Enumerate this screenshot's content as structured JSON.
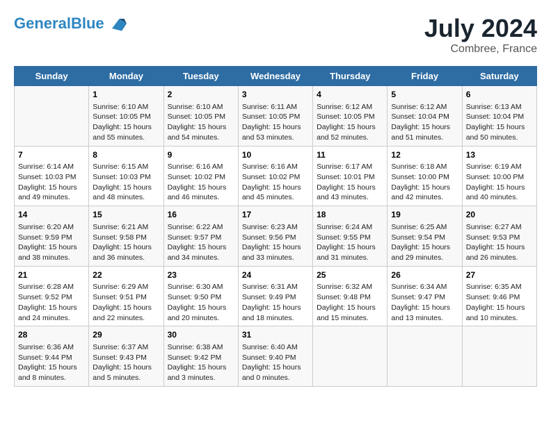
{
  "header": {
    "logo_line1": "General",
    "logo_line2": "Blue",
    "month": "July 2024",
    "location": "Combree, France"
  },
  "columns": [
    "Sunday",
    "Monday",
    "Tuesday",
    "Wednesday",
    "Thursday",
    "Friday",
    "Saturday"
  ],
  "weeks": [
    [
      {
        "day": "",
        "info": ""
      },
      {
        "day": "1",
        "info": "Sunrise: 6:10 AM\nSunset: 10:05 PM\nDaylight: 15 hours\nand 55 minutes."
      },
      {
        "day": "2",
        "info": "Sunrise: 6:10 AM\nSunset: 10:05 PM\nDaylight: 15 hours\nand 54 minutes."
      },
      {
        "day": "3",
        "info": "Sunrise: 6:11 AM\nSunset: 10:05 PM\nDaylight: 15 hours\nand 53 minutes."
      },
      {
        "day": "4",
        "info": "Sunrise: 6:12 AM\nSunset: 10:05 PM\nDaylight: 15 hours\nand 52 minutes."
      },
      {
        "day": "5",
        "info": "Sunrise: 6:12 AM\nSunset: 10:04 PM\nDaylight: 15 hours\nand 51 minutes."
      },
      {
        "day": "6",
        "info": "Sunrise: 6:13 AM\nSunset: 10:04 PM\nDaylight: 15 hours\nand 50 minutes."
      }
    ],
    [
      {
        "day": "7",
        "info": "Sunrise: 6:14 AM\nSunset: 10:03 PM\nDaylight: 15 hours\nand 49 minutes."
      },
      {
        "day": "8",
        "info": "Sunrise: 6:15 AM\nSunset: 10:03 PM\nDaylight: 15 hours\nand 48 minutes."
      },
      {
        "day": "9",
        "info": "Sunrise: 6:16 AM\nSunset: 10:02 PM\nDaylight: 15 hours\nand 46 minutes."
      },
      {
        "day": "10",
        "info": "Sunrise: 6:16 AM\nSunset: 10:02 PM\nDaylight: 15 hours\nand 45 minutes."
      },
      {
        "day": "11",
        "info": "Sunrise: 6:17 AM\nSunset: 10:01 PM\nDaylight: 15 hours\nand 43 minutes."
      },
      {
        "day": "12",
        "info": "Sunrise: 6:18 AM\nSunset: 10:00 PM\nDaylight: 15 hours\nand 42 minutes."
      },
      {
        "day": "13",
        "info": "Sunrise: 6:19 AM\nSunset: 10:00 PM\nDaylight: 15 hours\nand 40 minutes."
      }
    ],
    [
      {
        "day": "14",
        "info": "Sunrise: 6:20 AM\nSunset: 9:59 PM\nDaylight: 15 hours\nand 38 minutes."
      },
      {
        "day": "15",
        "info": "Sunrise: 6:21 AM\nSunset: 9:58 PM\nDaylight: 15 hours\nand 36 minutes."
      },
      {
        "day": "16",
        "info": "Sunrise: 6:22 AM\nSunset: 9:57 PM\nDaylight: 15 hours\nand 34 minutes."
      },
      {
        "day": "17",
        "info": "Sunrise: 6:23 AM\nSunset: 9:56 PM\nDaylight: 15 hours\nand 33 minutes."
      },
      {
        "day": "18",
        "info": "Sunrise: 6:24 AM\nSunset: 9:55 PM\nDaylight: 15 hours\nand 31 minutes."
      },
      {
        "day": "19",
        "info": "Sunrise: 6:25 AM\nSunset: 9:54 PM\nDaylight: 15 hours\nand 29 minutes."
      },
      {
        "day": "20",
        "info": "Sunrise: 6:27 AM\nSunset: 9:53 PM\nDaylight: 15 hours\nand 26 minutes."
      }
    ],
    [
      {
        "day": "21",
        "info": "Sunrise: 6:28 AM\nSunset: 9:52 PM\nDaylight: 15 hours\nand 24 minutes."
      },
      {
        "day": "22",
        "info": "Sunrise: 6:29 AM\nSunset: 9:51 PM\nDaylight: 15 hours\nand 22 minutes."
      },
      {
        "day": "23",
        "info": "Sunrise: 6:30 AM\nSunset: 9:50 PM\nDaylight: 15 hours\nand 20 minutes."
      },
      {
        "day": "24",
        "info": "Sunrise: 6:31 AM\nSunset: 9:49 PM\nDaylight: 15 hours\nand 18 minutes."
      },
      {
        "day": "25",
        "info": "Sunrise: 6:32 AM\nSunset: 9:48 PM\nDaylight: 15 hours\nand 15 minutes."
      },
      {
        "day": "26",
        "info": "Sunrise: 6:34 AM\nSunset: 9:47 PM\nDaylight: 15 hours\nand 13 minutes."
      },
      {
        "day": "27",
        "info": "Sunrise: 6:35 AM\nSunset: 9:46 PM\nDaylight: 15 hours\nand 10 minutes."
      }
    ],
    [
      {
        "day": "28",
        "info": "Sunrise: 6:36 AM\nSunset: 9:44 PM\nDaylight: 15 hours\nand 8 minutes."
      },
      {
        "day": "29",
        "info": "Sunrise: 6:37 AM\nSunset: 9:43 PM\nDaylight: 15 hours\nand 5 minutes."
      },
      {
        "day": "30",
        "info": "Sunrise: 6:38 AM\nSunset: 9:42 PM\nDaylight: 15 hours\nand 3 minutes."
      },
      {
        "day": "31",
        "info": "Sunrise: 6:40 AM\nSunset: 9:40 PM\nDaylight: 15 hours\nand 0 minutes."
      },
      {
        "day": "",
        "info": ""
      },
      {
        "day": "",
        "info": ""
      },
      {
        "day": "",
        "info": ""
      }
    ]
  ]
}
